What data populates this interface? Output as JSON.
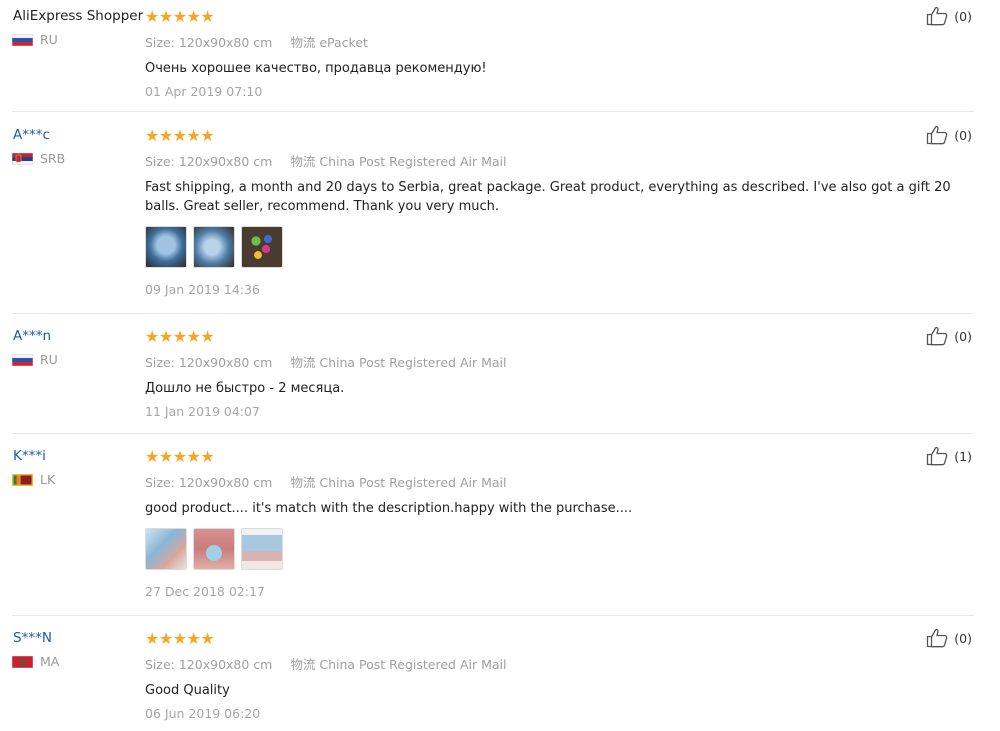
{
  "reviews": [
    {
      "user": "AliExpress Shopper",
      "country": "RU",
      "flag": "ru",
      "stars": "★★★★★",
      "size_label": "Size:",
      "size_value": "120x90x80 cm",
      "logistics_label": "物流",
      "logistics_value": "ePacket",
      "text": "Очень хорошее качество, продавца рекомендую!",
      "date": "01 Apr 2019 07:10",
      "helpful_count": "(0)",
      "photos": []
    },
    {
      "user": "A***c",
      "country": "SRB",
      "flag": "rs",
      "stars": "★★★★★",
      "size_label": "Size:",
      "size_value": "120x90x80 cm",
      "logistics_label": "物流",
      "logistics_value": "China Post Registered Air Mail",
      "text": "Fast shipping, a month and 20 days to Serbia, great package. Great product, everything as described. I've also got a gift 20 balls. Great seller, recommend. Thank you very much.",
      "date": "09 Jan 2019 14:36",
      "helpful_count": "(0)",
      "photos": [
        "photo-1",
        "photo-2",
        "photo-3"
      ]
    },
    {
      "user": "A***n",
      "country": "RU",
      "flag": "ru",
      "stars": "★★★★★",
      "size_label": "Size:",
      "size_value": "120x90x80 cm",
      "logistics_label": "物流",
      "logistics_value": "China Post Registered Air Mail",
      "text": "Дошло не быстро - 2 месяца.",
      "date": "11 Jan 2019 04:07",
      "helpful_count": "(0)",
      "photos": []
    },
    {
      "user": "K***i",
      "country": "LK",
      "flag": "lk",
      "stars": "★★★★★",
      "size_label": "Size:",
      "size_value": "120x90x80 cm",
      "logistics_label": "物流",
      "logistics_value": "China Post Registered Air Mail",
      "text": "good product.... it's match with the description.happy with the purchase....",
      "date": "27 Dec 2018 02:17",
      "helpful_count": "(1)",
      "photos": [
        "photo-1",
        "photo-2",
        "photo-3"
      ]
    },
    {
      "user": "S***N",
      "country": "MA",
      "flag": "ma",
      "stars": "★★★★★",
      "size_label": "Size:",
      "size_value": "120x90x80 cm",
      "logistics_label": "物流",
      "logistics_value": "China Post Registered Air Mail",
      "text": "Good Quality",
      "date": "06 Jun 2019 06:20",
      "helpful_count": "(0)",
      "photos": []
    }
  ],
  "colors": {
    "star": "#f5a623",
    "username_link": "#1e5aa8",
    "meta_gray": "#a0a0a0",
    "divider": "#e8e8e8"
  },
  "icons": {
    "helpful": "thumbs-up-icon",
    "rating": "star-icon"
  }
}
